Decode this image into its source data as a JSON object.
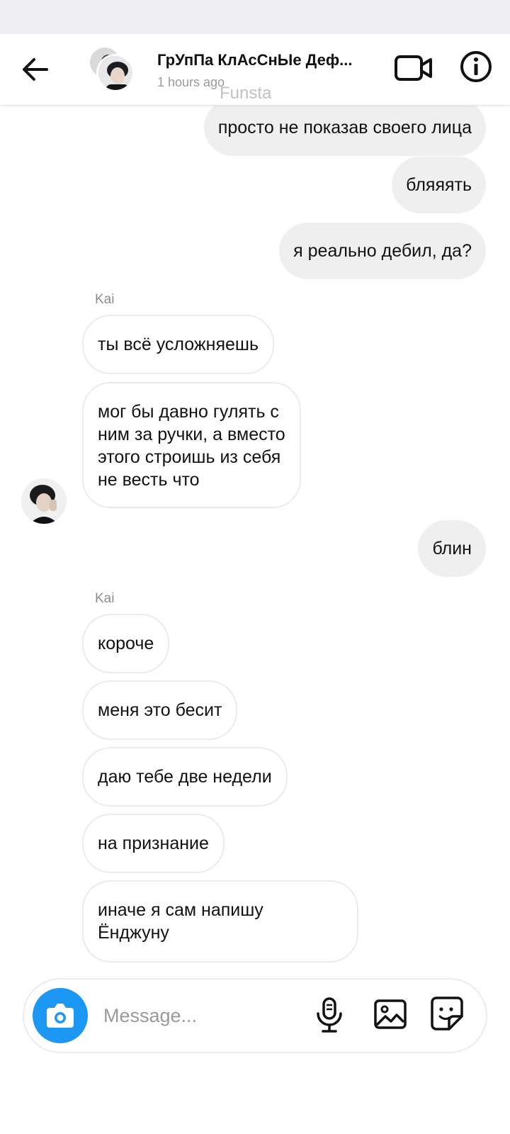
{
  "header": {
    "title": "ГрУпПа КлАсСнЫе Деф...",
    "subtitle": "1 hours ago",
    "watermark": "Funsta"
  },
  "icons": {
    "back": "arrow-left-icon",
    "video": "video-camera-icon",
    "info": "info-icon",
    "camera": "camera-icon",
    "mic": "microphone-icon",
    "gallery": "image-icon",
    "sticker": "sticker-icon"
  },
  "colors": {
    "accent": "#1c98f4",
    "outgoing_bubble": "#efeff0",
    "incoming_border": "#ebebeb"
  },
  "messages": [
    {
      "from": "me",
      "text": "просто не показав своего лица"
    },
    {
      "from": "me",
      "text": "бляяять"
    },
    {
      "from": "me",
      "text": "я реально дебил, да?"
    },
    {
      "sender_label": "Kai"
    },
    {
      "from": "Kai",
      "text": "ты всё усложняешь"
    },
    {
      "from": "Kai",
      "lines": [
        "мог бы давно гулять с",
        "ним за ручки, а вместо",
        "этого строишь из себя",
        "не весть что"
      ]
    },
    {
      "from": "me",
      "text": "блин"
    },
    {
      "sender_label": "Kai"
    },
    {
      "from": "Kai",
      "text": "короче"
    },
    {
      "from": "Kai",
      "text": "меня это бесит"
    },
    {
      "from": "Kai",
      "text": "даю тебе две недели"
    },
    {
      "from": "Kai",
      "text": "на признание"
    },
    {
      "from": "Kai",
      "lines": [
        "иначе я сам напишу",
        "Ёнджуну"
      ]
    }
  ],
  "composer": {
    "placeholder": "Message..."
  }
}
